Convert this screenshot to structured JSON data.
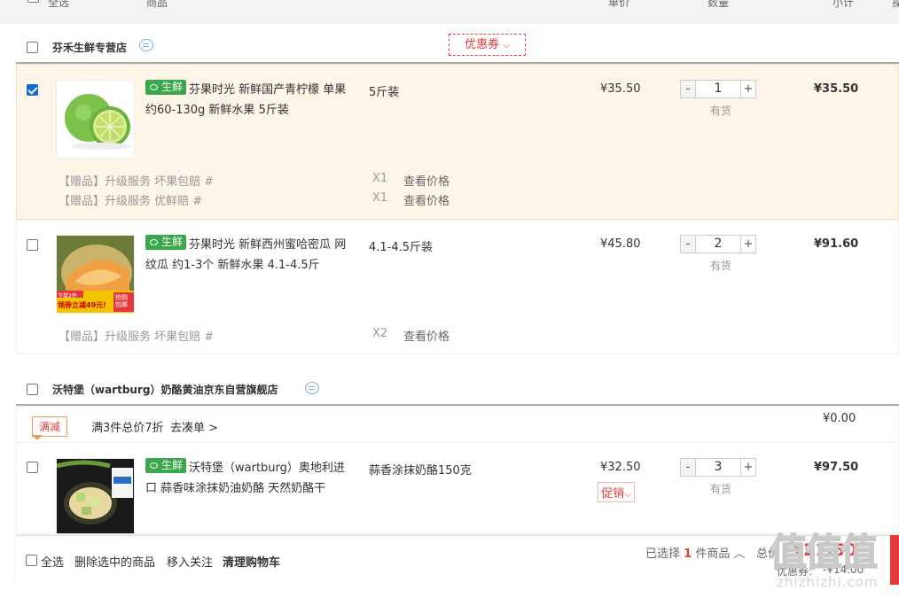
{
  "header": {
    "select_all": "全选",
    "product": "商品",
    "unit_price": "单价",
    "quantity": "数量",
    "subtotal": "小计",
    "operation": "操"
  },
  "shops": [
    {
      "name": "芬禾生鲜专营店",
      "coupon_label": "优惠券",
      "items": [
        {
          "title": "芬果时光 新鲜国产青柠檬 单果约60-130g 新鲜水果 5斤装",
          "fresh_label": "生鲜",
          "spec": "5斤装",
          "price": "¥35.50",
          "qty": "1",
          "stock": "有货",
          "subtotal": "¥35.50",
          "checked": true,
          "gifts": [
            {
              "label": "【赠品】升级服务 坏果包赔 #",
              "qty": "X1",
              "link": "查看价格"
            },
            {
              "label": "【赠品】升级服务 优鲜赔 #",
              "qty": "X1",
              "link": "查看价格"
            }
          ]
        },
        {
          "title": "芬果时光 新鲜西州蜜哈密瓜 网纹瓜 约1-3个 新鲜水果 4.1-4.5斤",
          "fresh_label": "生鲜",
          "spec": "4.1-4.5斤装",
          "price": "¥45.80",
          "qty": "2",
          "stock": "有货",
          "subtotal": "¥91.60",
          "checked": false,
          "thumb_banner": "领券立减49元!",
          "thumb_top": "下单2件",
          "thumb_corner": "抢购包邮",
          "gifts": [
            {
              "label": "【赠品】升级服务 坏果包赔 #",
              "qty": "X2",
              "link": "查看价格"
            }
          ]
        }
      ]
    },
    {
      "name": "沃特堡（wartburg）奶酪黄油京东自营旗舰店",
      "promo_group": {
        "tag": "满减",
        "desc": "满3件总价7折",
        "link": "去凑单 >",
        "discount": "¥0.00"
      },
      "items": [
        {
          "title": "沃特堡（wartburg）奥地利进口 蒜香味涂抹奶油奶酪 天然奶酪干",
          "fresh_label": "生鲜",
          "spec": "蒜香涂抹奶酪150克",
          "price": "¥32.50",
          "promo_label": "促销",
          "qty": "3",
          "stock": "有货",
          "subtotal": "¥97.50",
          "checked": false
        }
      ]
    }
  ],
  "footer": {
    "select_all": "全选",
    "delete_selected": "删除选中的商品",
    "move_to_follow": "移入关注",
    "clear_cart": "清理购物车",
    "selected_prefix": "已选择",
    "selected_count": "1",
    "selected_suffix": "件商品",
    "total_label": "总价",
    "total_value": "¥21.50",
    "discount_label": "优惠券:",
    "discount_value": "-¥14.00"
  },
  "watermark": {
    "text": "值值值",
    "url": "zhizhizhi.com"
  },
  "colors": {
    "accent_red": "#e4393c",
    "fresh_green": "#3aa74b",
    "selected_row_bg": "#fff4e8"
  }
}
